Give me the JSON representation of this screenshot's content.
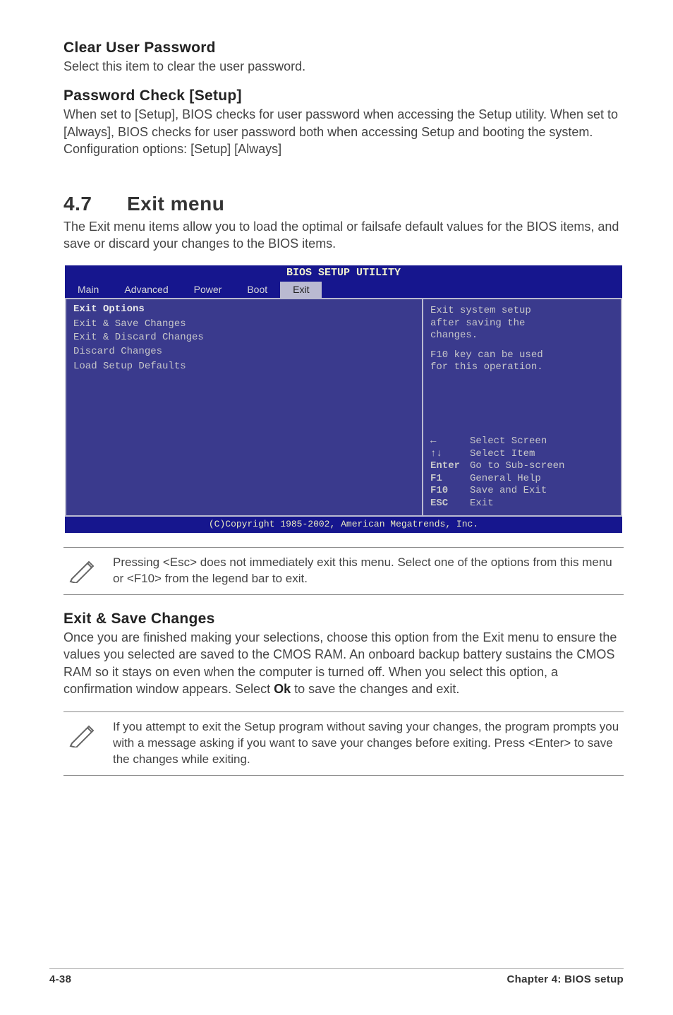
{
  "sections": {
    "clear_user_password": {
      "heading": "Clear User Password",
      "body": "Select this item to clear the user password."
    },
    "password_check": {
      "heading": "Password Check [Setup]",
      "body": "When set to [Setup], BIOS checks for user password when accessing the Setup utility. When set to [Always], BIOS checks for user password both when accessing Setup and booting the system.\nConfiguration options: [Setup] [Always]"
    },
    "exit_menu": {
      "number": "4.7",
      "title": "Exit menu",
      "intro": "The Exit menu items allow you to load the optimal or failsafe default values for the BIOS items, and save or discard your changes to the BIOS items."
    },
    "exit_save_changes": {
      "heading": "Exit & Save Changes",
      "body_pre": "Once you are finished making your selections, choose this option from the Exit menu to ensure the values you selected are saved to the CMOS RAM. An onboard backup battery sustains the CMOS RAM so it stays on even when the computer is turned off. When you select this option, a confirmation window appears. Select ",
      "body_bold": "Ok",
      "body_post": " to save the changes and exit."
    }
  },
  "bios": {
    "title": "BIOS SETUP UTILITY",
    "tabs": [
      "Main",
      "Advanced",
      "Power",
      "Boot",
      "Exit"
    ],
    "active_tab": "Exit",
    "left": {
      "heading": "Exit Options",
      "items": [
        "Exit & Save Changes",
        "Exit & Discard Changes",
        "Discard Changes",
        "",
        "Load Setup Defaults"
      ]
    },
    "help": [
      "Exit system setup",
      "after saving the",
      "changes.",
      "",
      "F10 key can be used",
      "for this operation."
    ],
    "legend": [
      {
        "key": "←",
        "action": "Select Screen"
      },
      {
        "key": "↑↓",
        "action": "Select Item"
      },
      {
        "key": "Enter",
        "action": "Go to Sub-screen"
      },
      {
        "key": "F1",
        "action": "General Help"
      },
      {
        "key": "F10",
        "action": "Save and Exit"
      },
      {
        "key": "ESC",
        "action": "Exit"
      }
    ],
    "footer": "(C)Copyright 1985-2002, American Megatrends, Inc."
  },
  "notes": {
    "esc": "Pressing <Esc> does not immediately exit this menu. Select one of the options from this menu or <F10> from the legend bar to exit.",
    "exit_no_save": " If you attempt to exit the Setup program without saving your changes, the program prompts you with a message asking if you want to save your changes before exiting. Press <Enter>  to save the  changes while exiting."
  },
  "footer": {
    "page": "4-38",
    "chapter": "Chapter 4: BIOS setup"
  }
}
